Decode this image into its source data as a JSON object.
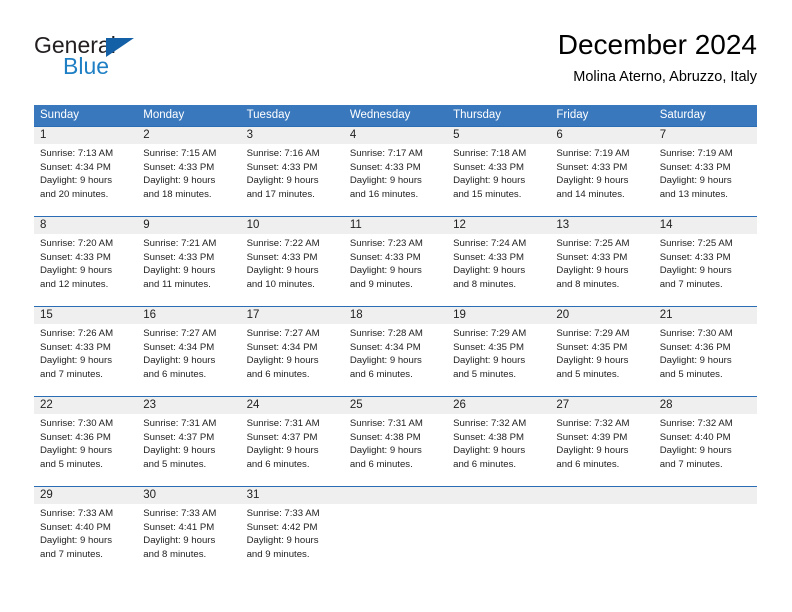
{
  "brand": {
    "name_part1": "General",
    "name_part2": "Blue",
    "triangle_color": "#1360a6",
    "blue_color": "#1f7fc4"
  },
  "header": {
    "title": "December 2024",
    "subtitle": "Molina Aterno, Abruzzo, Italy"
  },
  "theme": {
    "header_bar_color": "#3a78bd",
    "row_divider_color": "#2a6db5",
    "day_band_color": "#efefef"
  },
  "weekdays": [
    "Sunday",
    "Monday",
    "Tuesday",
    "Wednesday",
    "Thursday",
    "Friday",
    "Saturday"
  ],
  "weeks": [
    [
      {
        "day": "1",
        "sunrise": "Sunrise: 7:13 AM",
        "sunset": "Sunset: 4:34 PM",
        "daylight_line1": "Daylight: 9 hours",
        "daylight_line2": "and 20 minutes."
      },
      {
        "day": "2",
        "sunrise": "Sunrise: 7:15 AM",
        "sunset": "Sunset: 4:33 PM",
        "daylight_line1": "Daylight: 9 hours",
        "daylight_line2": "and 18 minutes."
      },
      {
        "day": "3",
        "sunrise": "Sunrise: 7:16 AM",
        "sunset": "Sunset: 4:33 PM",
        "daylight_line1": "Daylight: 9 hours",
        "daylight_line2": "and 17 minutes."
      },
      {
        "day": "4",
        "sunrise": "Sunrise: 7:17 AM",
        "sunset": "Sunset: 4:33 PM",
        "daylight_line1": "Daylight: 9 hours",
        "daylight_line2": "and 16 minutes."
      },
      {
        "day": "5",
        "sunrise": "Sunrise: 7:18 AM",
        "sunset": "Sunset: 4:33 PM",
        "daylight_line1": "Daylight: 9 hours",
        "daylight_line2": "and 15 minutes."
      },
      {
        "day": "6",
        "sunrise": "Sunrise: 7:19 AM",
        "sunset": "Sunset: 4:33 PM",
        "daylight_line1": "Daylight: 9 hours",
        "daylight_line2": "and 14 minutes."
      },
      {
        "day": "7",
        "sunrise": "Sunrise: 7:19 AM",
        "sunset": "Sunset: 4:33 PM",
        "daylight_line1": "Daylight: 9 hours",
        "daylight_line2": "and 13 minutes."
      }
    ],
    [
      {
        "day": "8",
        "sunrise": "Sunrise: 7:20 AM",
        "sunset": "Sunset: 4:33 PM",
        "daylight_line1": "Daylight: 9 hours",
        "daylight_line2": "and 12 minutes."
      },
      {
        "day": "9",
        "sunrise": "Sunrise: 7:21 AM",
        "sunset": "Sunset: 4:33 PM",
        "daylight_line1": "Daylight: 9 hours",
        "daylight_line2": "and 11 minutes."
      },
      {
        "day": "10",
        "sunrise": "Sunrise: 7:22 AM",
        "sunset": "Sunset: 4:33 PM",
        "daylight_line1": "Daylight: 9 hours",
        "daylight_line2": "and 10 minutes."
      },
      {
        "day": "11",
        "sunrise": "Sunrise: 7:23 AM",
        "sunset": "Sunset: 4:33 PM",
        "daylight_line1": "Daylight: 9 hours",
        "daylight_line2": "and 9 minutes."
      },
      {
        "day": "12",
        "sunrise": "Sunrise: 7:24 AM",
        "sunset": "Sunset: 4:33 PM",
        "daylight_line1": "Daylight: 9 hours",
        "daylight_line2": "and 8 minutes."
      },
      {
        "day": "13",
        "sunrise": "Sunrise: 7:25 AM",
        "sunset": "Sunset: 4:33 PM",
        "daylight_line1": "Daylight: 9 hours",
        "daylight_line2": "and 8 minutes."
      },
      {
        "day": "14",
        "sunrise": "Sunrise: 7:25 AM",
        "sunset": "Sunset: 4:33 PM",
        "daylight_line1": "Daylight: 9 hours",
        "daylight_line2": "and 7 minutes."
      }
    ],
    [
      {
        "day": "15",
        "sunrise": "Sunrise: 7:26 AM",
        "sunset": "Sunset: 4:33 PM",
        "daylight_line1": "Daylight: 9 hours",
        "daylight_line2": "and 7 minutes."
      },
      {
        "day": "16",
        "sunrise": "Sunrise: 7:27 AM",
        "sunset": "Sunset: 4:34 PM",
        "daylight_line1": "Daylight: 9 hours",
        "daylight_line2": "and 6 minutes."
      },
      {
        "day": "17",
        "sunrise": "Sunrise: 7:27 AM",
        "sunset": "Sunset: 4:34 PM",
        "daylight_line1": "Daylight: 9 hours",
        "daylight_line2": "and 6 minutes."
      },
      {
        "day": "18",
        "sunrise": "Sunrise: 7:28 AM",
        "sunset": "Sunset: 4:34 PM",
        "daylight_line1": "Daylight: 9 hours",
        "daylight_line2": "and 6 minutes."
      },
      {
        "day": "19",
        "sunrise": "Sunrise: 7:29 AM",
        "sunset": "Sunset: 4:35 PM",
        "daylight_line1": "Daylight: 9 hours",
        "daylight_line2": "and 5 minutes."
      },
      {
        "day": "20",
        "sunrise": "Sunrise: 7:29 AM",
        "sunset": "Sunset: 4:35 PM",
        "daylight_line1": "Daylight: 9 hours",
        "daylight_line2": "and 5 minutes."
      },
      {
        "day": "21",
        "sunrise": "Sunrise: 7:30 AM",
        "sunset": "Sunset: 4:36 PM",
        "daylight_line1": "Daylight: 9 hours",
        "daylight_line2": "and 5 minutes."
      }
    ],
    [
      {
        "day": "22",
        "sunrise": "Sunrise: 7:30 AM",
        "sunset": "Sunset: 4:36 PM",
        "daylight_line1": "Daylight: 9 hours",
        "daylight_line2": "and 5 minutes."
      },
      {
        "day": "23",
        "sunrise": "Sunrise: 7:31 AM",
        "sunset": "Sunset: 4:37 PM",
        "daylight_line1": "Daylight: 9 hours",
        "daylight_line2": "and 5 minutes."
      },
      {
        "day": "24",
        "sunrise": "Sunrise: 7:31 AM",
        "sunset": "Sunset: 4:37 PM",
        "daylight_line1": "Daylight: 9 hours",
        "daylight_line2": "and 6 minutes."
      },
      {
        "day": "25",
        "sunrise": "Sunrise: 7:31 AM",
        "sunset": "Sunset: 4:38 PM",
        "daylight_line1": "Daylight: 9 hours",
        "daylight_line2": "and 6 minutes."
      },
      {
        "day": "26",
        "sunrise": "Sunrise: 7:32 AM",
        "sunset": "Sunset: 4:38 PM",
        "daylight_line1": "Daylight: 9 hours",
        "daylight_line2": "and 6 minutes."
      },
      {
        "day": "27",
        "sunrise": "Sunrise: 7:32 AM",
        "sunset": "Sunset: 4:39 PM",
        "daylight_line1": "Daylight: 9 hours",
        "daylight_line2": "and 6 minutes."
      },
      {
        "day": "28",
        "sunrise": "Sunrise: 7:32 AM",
        "sunset": "Sunset: 4:40 PM",
        "daylight_line1": "Daylight: 9 hours",
        "daylight_line2": "and 7 minutes."
      }
    ],
    [
      {
        "day": "29",
        "sunrise": "Sunrise: 7:33 AM",
        "sunset": "Sunset: 4:40 PM",
        "daylight_line1": "Daylight: 9 hours",
        "daylight_line2": "and 7 minutes."
      },
      {
        "day": "30",
        "sunrise": "Sunrise: 7:33 AM",
        "sunset": "Sunset: 4:41 PM",
        "daylight_line1": "Daylight: 9 hours",
        "daylight_line2": "and 8 minutes."
      },
      {
        "day": "31",
        "sunrise": "Sunrise: 7:33 AM",
        "sunset": "Sunset: 4:42 PM",
        "daylight_line1": "Daylight: 9 hours",
        "daylight_line2": "and 9 minutes."
      },
      {
        "day": "",
        "sunrise": "",
        "sunset": "",
        "daylight_line1": "",
        "daylight_line2": ""
      },
      {
        "day": "",
        "sunrise": "",
        "sunset": "",
        "daylight_line1": "",
        "daylight_line2": ""
      },
      {
        "day": "",
        "sunrise": "",
        "sunset": "",
        "daylight_line1": "",
        "daylight_line2": ""
      },
      {
        "day": "",
        "sunrise": "",
        "sunset": "",
        "daylight_line1": "",
        "daylight_line2": ""
      }
    ]
  ]
}
